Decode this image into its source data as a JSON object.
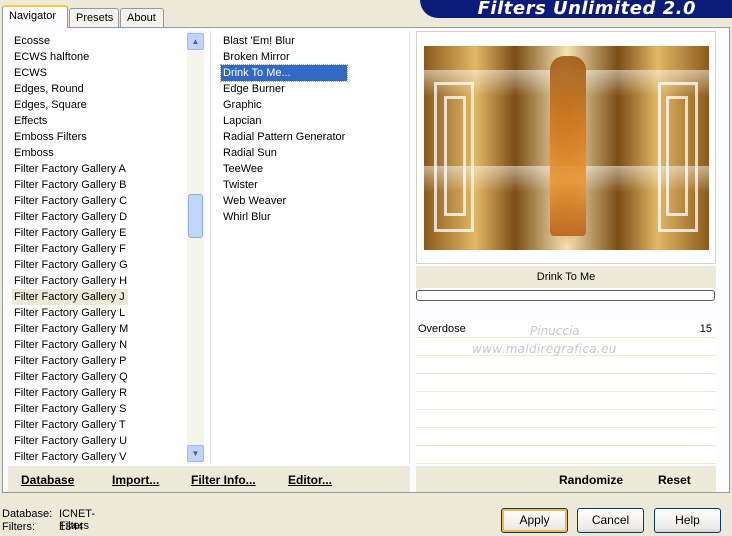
{
  "tabs": [
    {
      "label": "Navigator",
      "active": true
    },
    {
      "label": "Presets",
      "active": false
    },
    {
      "label": "About",
      "active": false
    }
  ],
  "banner": {
    "title": "Filters Unlimited 2.0"
  },
  "categories": {
    "items": [
      "Ecosse",
      "ECWS halftone",
      "ECWS",
      "Edges, Round",
      "Edges, Square",
      "Effects",
      "Emboss Filters",
      "Emboss",
      "Filter Factory Gallery A",
      "Filter Factory Gallery B",
      "Filter Factory Gallery C",
      "Filter Factory Gallery D",
      "Filter Factory Gallery E",
      "Filter Factory Gallery F",
      "Filter Factory Gallery G",
      "Filter Factory Gallery H",
      "Filter Factory Gallery J",
      "Filter Factory Gallery L",
      "Filter Factory Gallery M",
      "Filter Factory Gallery N",
      "Filter Factory Gallery P",
      "Filter Factory Gallery Q",
      "Filter Factory Gallery R",
      "Filter Factory Gallery S",
      "Filter Factory Gallery T",
      "Filter Factory Gallery U",
      "Filter Factory Gallery V"
    ],
    "selected": "Filter Factory Gallery J"
  },
  "filters": {
    "items": [
      "Blast 'Em! Blur",
      "Broken Mirror",
      "Drink To Me...",
      "Edge Burner",
      "Graphic",
      "Lapcian",
      "Radial Pattern Generator",
      "Radial Sun",
      "TeeWee",
      "Twister",
      "Web Weaver",
      "Whirl Blur"
    ],
    "selected": "Drink To Me..."
  },
  "preview": {
    "filter_name": "Drink To Me",
    "progress": 0
  },
  "params": [
    {
      "name": "Overdose",
      "value": "15"
    }
  ],
  "watermark": {
    "line1": "Pinuccia",
    "line2": "www.maldiregrafica.eu"
  },
  "links_left": {
    "database": "Database",
    "import": "Import...",
    "filter_info": "Filter Info...",
    "editor": "Editor..."
  },
  "links_right": {
    "randomize": "Randomize",
    "reset": "Reset"
  },
  "status": {
    "database_label": "Database:",
    "database_value": "ICNET-Filters",
    "filters_label": "Filters:",
    "filters_value": "1344"
  },
  "buttons": {
    "apply": "Apply",
    "cancel": "Cancel",
    "help": "Help"
  },
  "colors": {
    "selection": "#316ac5",
    "banner": "#0a1c77",
    "dialog": "#ece9d8"
  }
}
